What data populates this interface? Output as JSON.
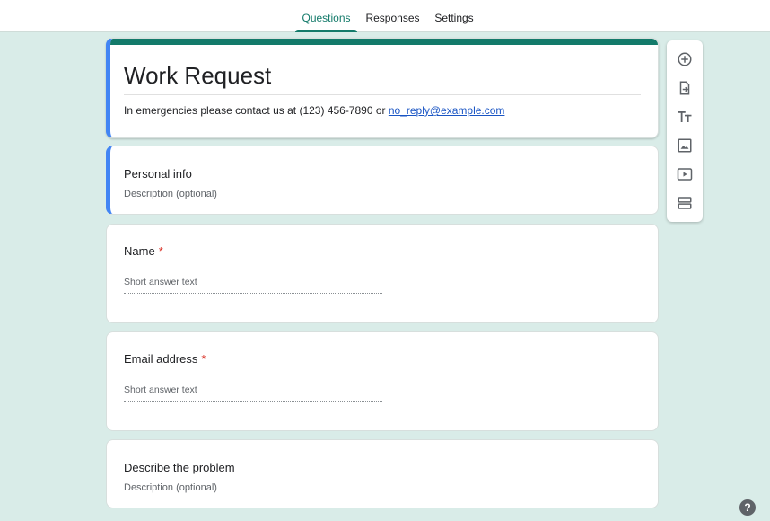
{
  "tabs": [
    {
      "label": "Questions",
      "active": true
    },
    {
      "label": "Responses",
      "active": false
    },
    {
      "label": "Settings",
      "active": false
    }
  ],
  "form": {
    "title": "Work Request",
    "description_prefix": "In emergencies please contact us at (123) 456-7890 or ",
    "description_link": "no_reply@example.com"
  },
  "sections": [
    {
      "title": "Personal info",
      "description_placeholder": "Description (optional)"
    },
    {
      "title": "Describe the problem",
      "description_placeholder": "Description (optional)"
    }
  ],
  "questions": [
    {
      "title": "Name",
      "required_mark": "*",
      "answer_placeholder": "Short answer text"
    },
    {
      "title": "Email address",
      "required_mark": "*",
      "answer_placeholder": "Short answer text"
    }
  ],
  "toolbar_icons": [
    "add-question-icon",
    "import-questions-icon",
    "add-title-icon",
    "add-image-icon",
    "add-video-icon",
    "add-section-icon"
  ],
  "help": {
    "label": "?"
  },
  "colors": {
    "accent": "#137a6a",
    "background": "#d9ece8",
    "selected_border": "#4285f4",
    "required": "#d93025",
    "link": "#1a55c4"
  }
}
